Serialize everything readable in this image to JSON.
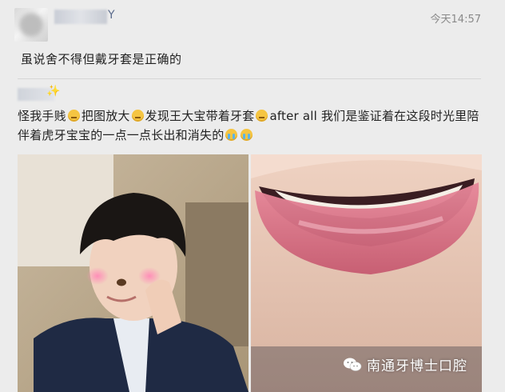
{
  "post": {
    "username_suffix": "Y",
    "timestamp": "今天14:57",
    "original_text": "虽说舍不得但戴牙套是正确的"
  },
  "reply": {
    "segments": [
      "怪我手贱",
      "把图放大",
      "发现王大宝带着牙套",
      "after all 我们是鉴证着在这段时光里陪伴着虎牙宝宝的一点一点长出和消失的"
    ]
  },
  "watermark": {
    "text": "南通牙博士口腔",
    "icon": "wechat-icon"
  },
  "colors": {
    "background": "#ececec",
    "username": "#5b6b8c",
    "timestamp": "#8a8a8a",
    "emoji": "#f5c542"
  }
}
